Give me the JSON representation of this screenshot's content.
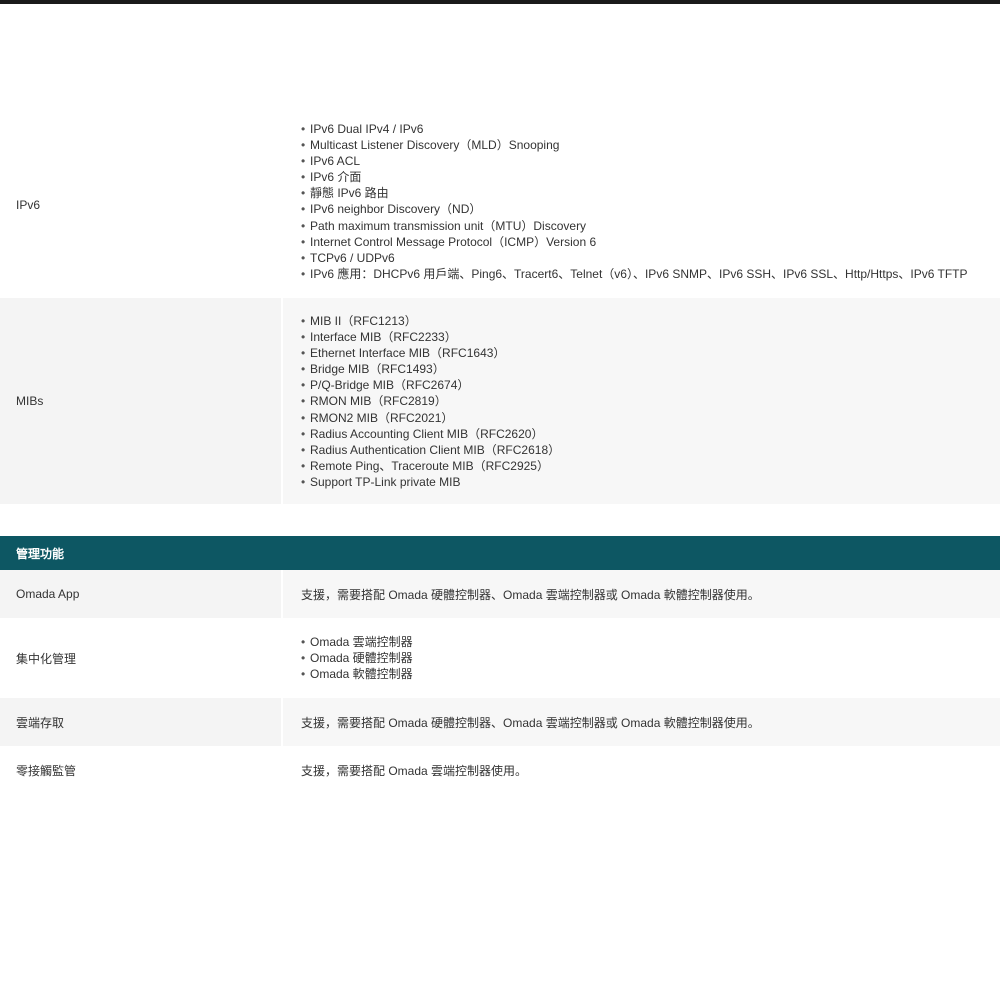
{
  "ipv6": {
    "label": "IPv6",
    "items": [
      "IPv6 Dual IPv4 / IPv6",
      "Multicast Listener Discovery（MLD）Snooping",
      "IPv6 ACL",
      "IPv6 介面",
      "靜態 IPv6 路由",
      "IPv6 neighbor Discovery（ND）",
      "Path maximum transmission unit（MTU）Discovery",
      "Internet Control Message Protocol（ICMP）Version 6",
      "TCPv6 / UDPv6",
      "IPv6 應用：DHCPv6 用戶端、Ping6、Tracert6、Telnet（v6）、IPv6 SNMP、IPv6 SSH、IPv6 SSL、Http/Https、IPv6 TFTP"
    ]
  },
  "mibs": {
    "label": "MIBs",
    "items": [
      "MIB II（RFC1213）",
      "Interface MIB（RFC2233）",
      "Ethernet Interface MIB（RFC1643）",
      "Bridge MIB（RFC1493）",
      "P/Q-Bridge MIB（RFC2674）",
      "RMON MIB（RFC2819）",
      "RMON2 MIB（RFC2021）",
      "Radius Accounting Client MIB（RFC2620）",
      "Radius Authentication Client MIB（RFC2618）",
      "Remote Ping、Traceroute MIB（RFC2925）",
      "Support TP-Link private MIB"
    ]
  },
  "management": {
    "header": "管理功能",
    "omada_app": {
      "label": "Omada App",
      "value": "支援，需要搭配 Omada 硬體控制器、Omada 雲端控制器或 Omada 軟體控制器使用。"
    },
    "centralized": {
      "label": "集中化管理",
      "items": [
        "Omada 雲端控制器",
        "Omada 硬體控制器",
        "Omada 軟體控制器"
      ]
    },
    "cloud_access": {
      "label": "雲端存取",
      "value": "支援，需要搭配 Omada 硬體控制器、Omada 雲端控制器或 Omada 軟體控制器使用。"
    },
    "zero_touch": {
      "label": "零接觸監管",
      "value": "支援，需要搭配 Omada 雲端控制器使用。"
    }
  }
}
